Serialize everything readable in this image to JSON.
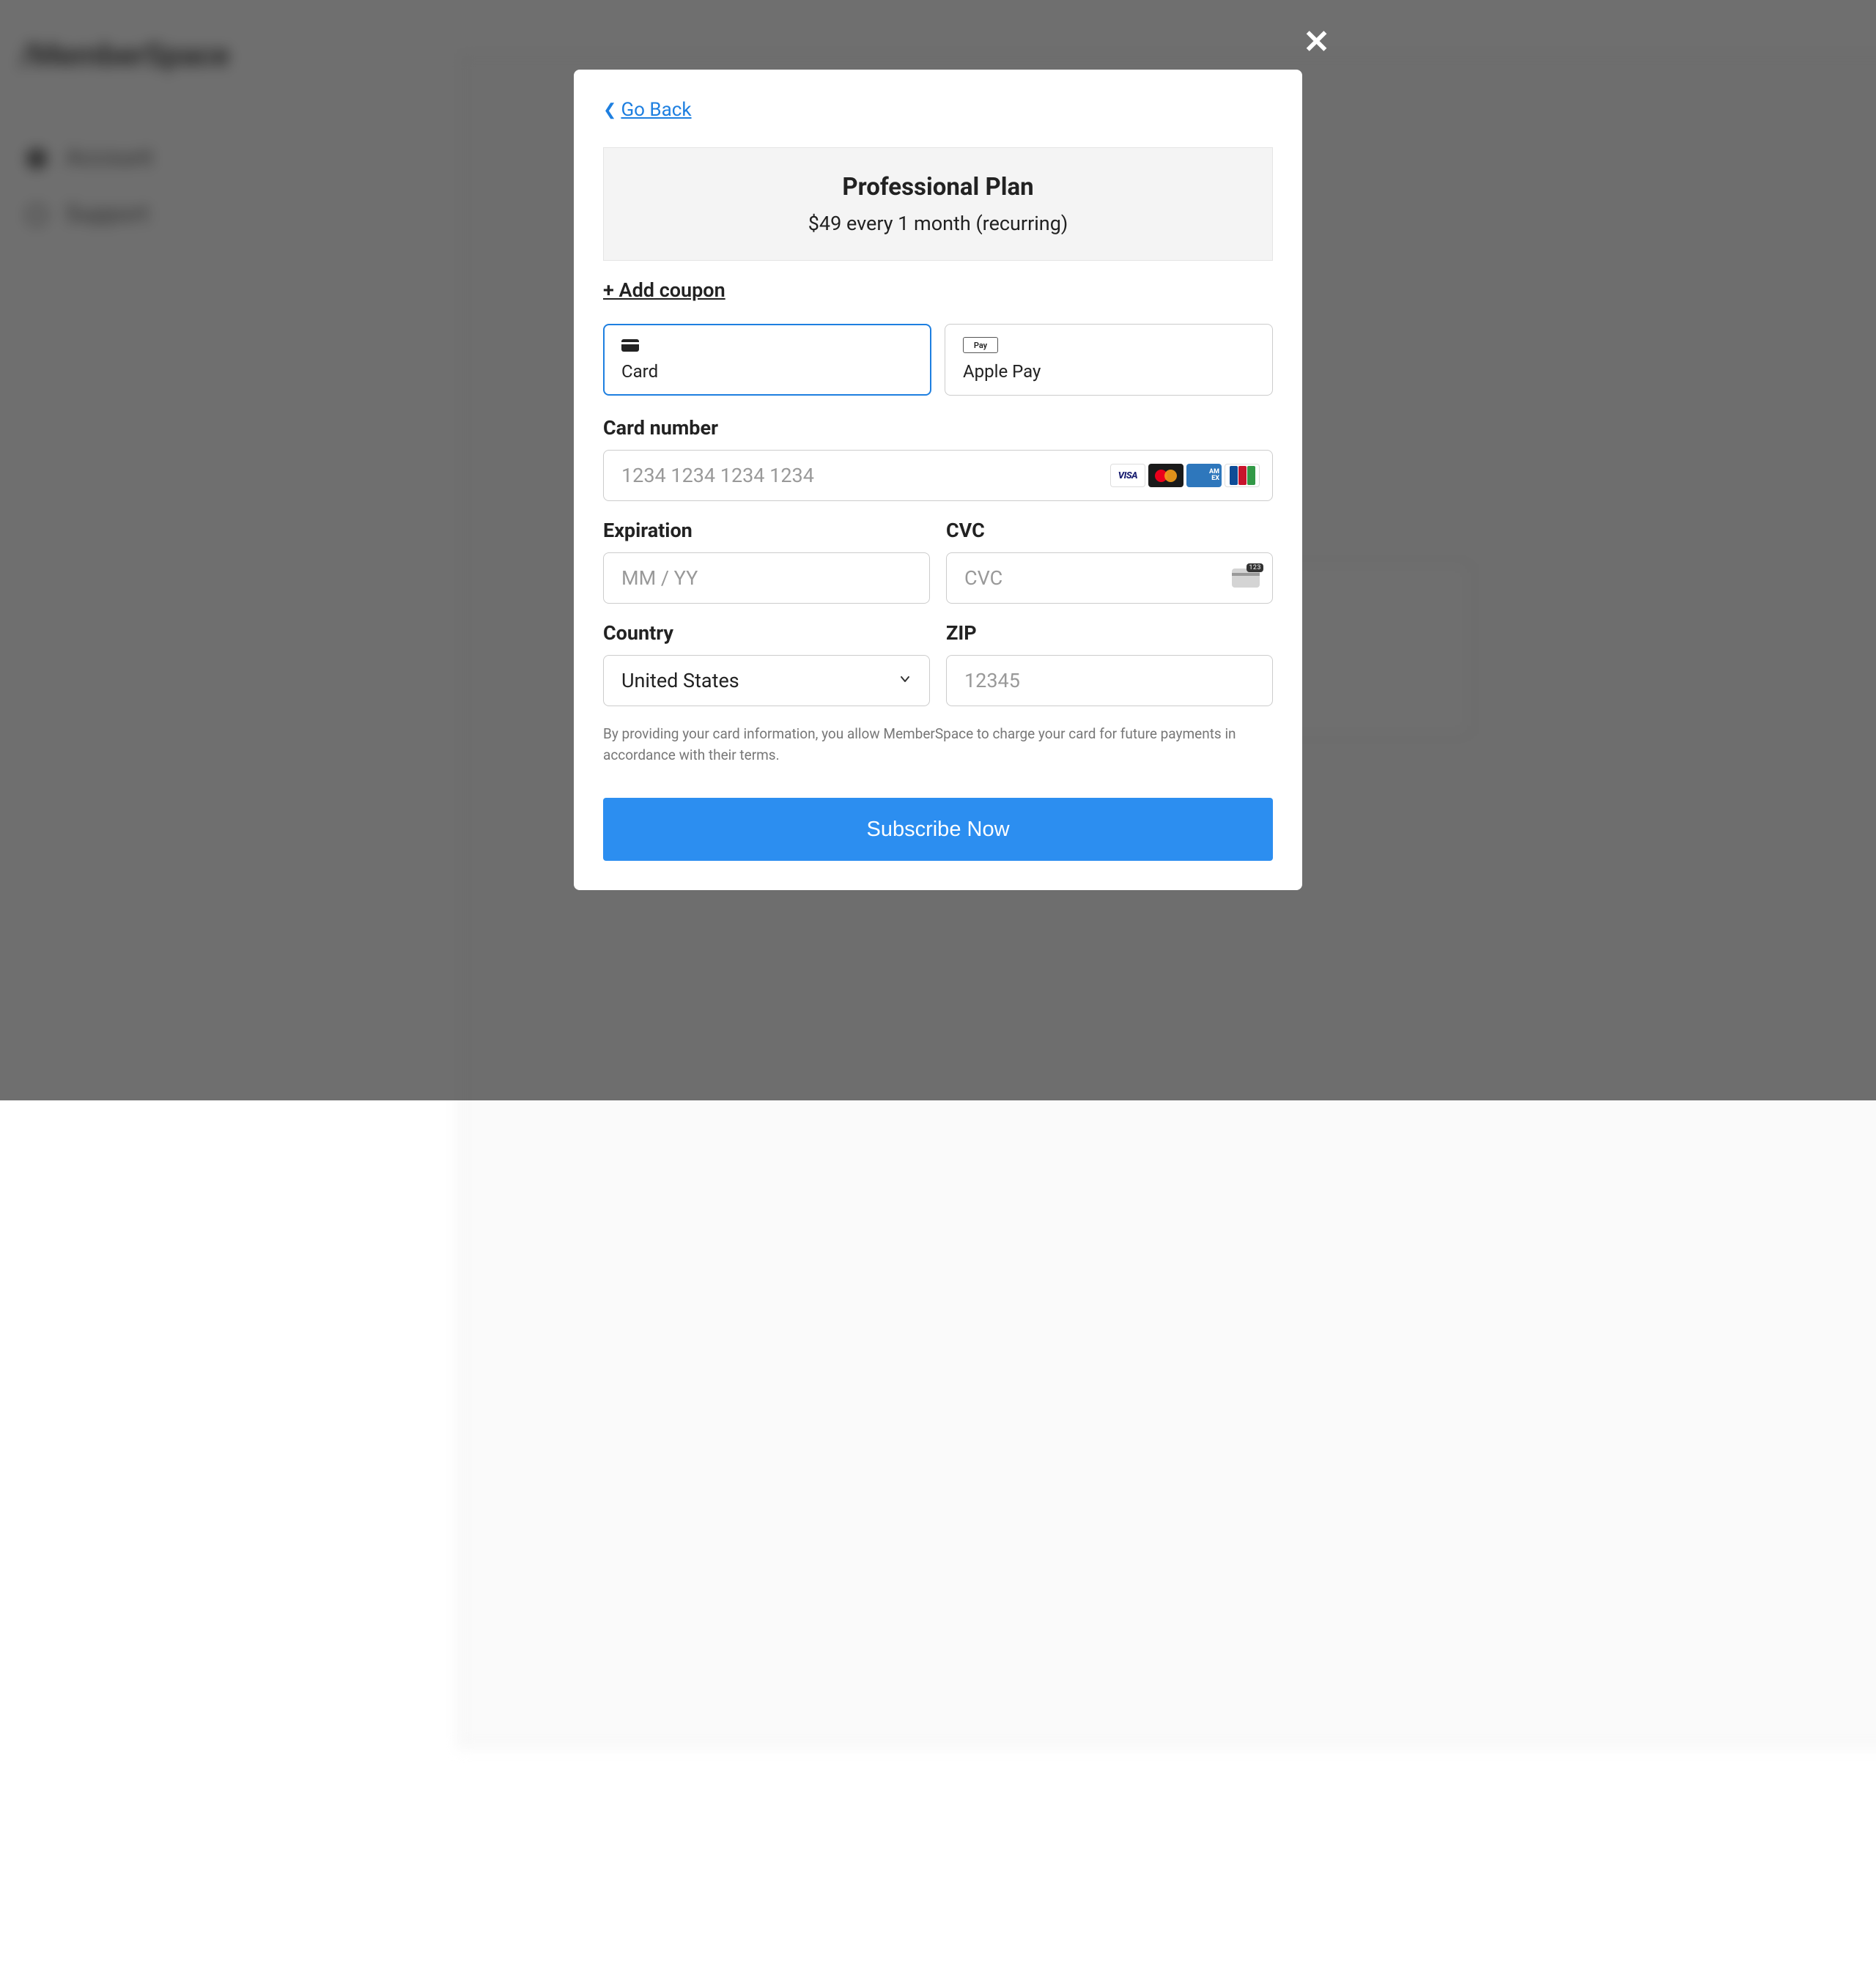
{
  "background": {
    "logo": "MemberSpace",
    "sidebar": [
      {
        "label": "Account"
      },
      {
        "label": "Support"
      }
    ]
  },
  "modal": {
    "go_back": "Go Back",
    "plan": {
      "title": "Professional Plan",
      "price": "$49 every 1 month (recurring)"
    },
    "add_coupon": "+ Add coupon",
    "payment_methods": {
      "card": "Card",
      "apple_pay": "Apple Pay",
      "apple_pay_icon_text": "Pay"
    },
    "fields": {
      "card_number_label": "Card number",
      "card_number_placeholder": "1234 1234 1234 1234",
      "expiration_label": "Expiration",
      "expiration_placeholder": "MM / YY",
      "cvc_label": "CVC",
      "cvc_placeholder": "CVC",
      "cvc_icon_text": "123",
      "country_label": "Country",
      "country_value": "United States",
      "zip_label": "ZIP",
      "zip_placeholder": "12345"
    },
    "card_brands": {
      "visa": "VISA",
      "amex": "AM\nEX"
    },
    "disclaimer": "By providing your card information, you allow MemberSpace to charge your card for future payments in accordance with their terms.",
    "subscribe_button": "Subscribe Now"
  }
}
